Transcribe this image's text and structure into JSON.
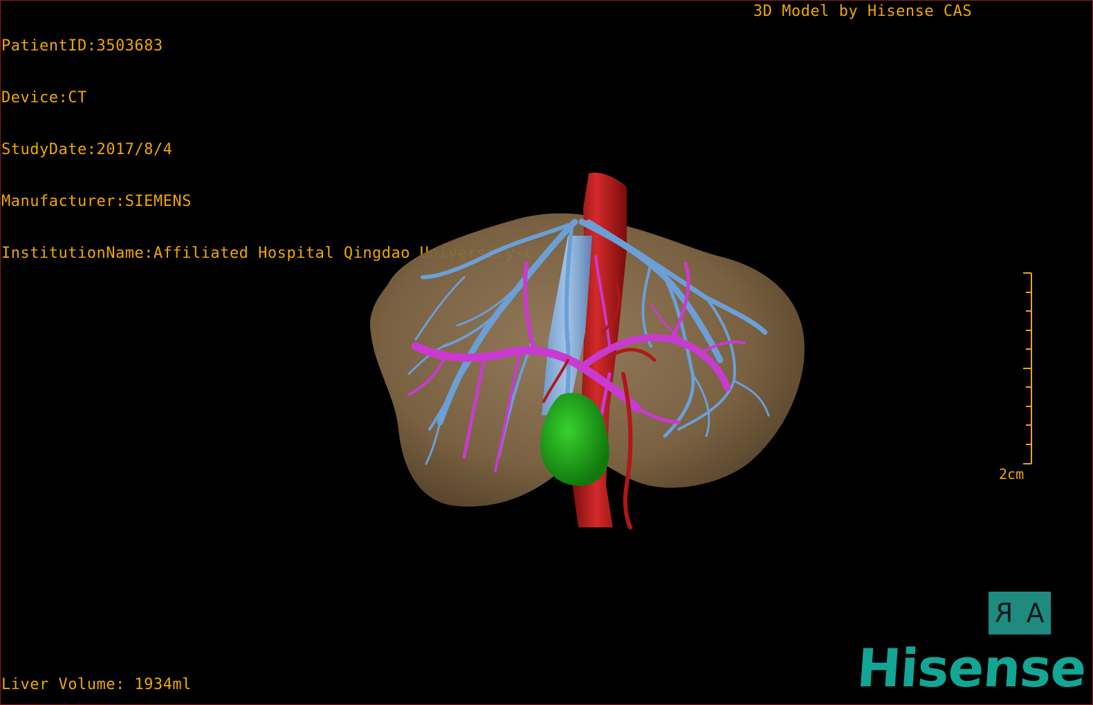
{
  "overlay": {
    "patient_id": "PatientID:3503683",
    "device": "Device:CT",
    "study_date": "StudyDate:2017/8/4",
    "manufacturer": "Manufacturer:SIEMENS",
    "institution": "InstitutionName:Affiliated Hospital Qingdao University-C",
    "title": "3D Model by Hisense CAS",
    "liver_volume": "Liver Volume: 1934ml"
  },
  "scale": {
    "label": "2cm"
  },
  "orientation": {
    "left_glyph": "R",
    "right_glyph": "A"
  },
  "brand": {
    "logo_text": "Hisense"
  },
  "colors": {
    "overlay_text": "#f0a800",
    "liver": "#8b7252",
    "hepatic_veins": "#6b9fd6",
    "portal_vein": "#c93ad0",
    "artery": "#b01818",
    "gallbladder": "#1fa51a",
    "brand": "#13a595"
  },
  "model": {
    "structures": [
      "liver",
      "hepatic-veins",
      "vena-cava",
      "portal-vein",
      "aorta",
      "gallbladder"
    ]
  }
}
